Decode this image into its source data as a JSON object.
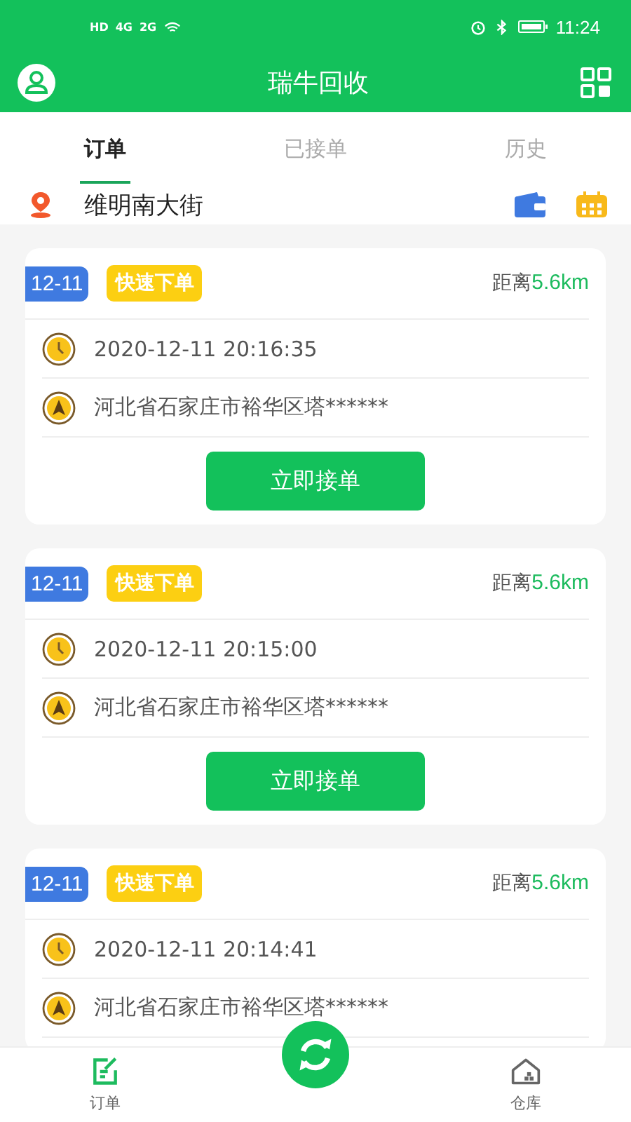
{
  "status_bar": {
    "indicators": [
      "HD",
      "4G",
      "2G"
    ],
    "time": "11:24"
  },
  "header": {
    "title": "瑞牛回收"
  },
  "tabs": [
    {
      "label": "订单",
      "selected": true
    },
    {
      "label": "已接单",
      "selected": false
    },
    {
      "label": "历史",
      "selected": false
    }
  ],
  "location": {
    "street": "维明南大街"
  },
  "orders": [
    {
      "date": "12-11",
      "tag": "快速下单",
      "distance_label": "距离",
      "distance": "5.6km",
      "time": "2020-12-11 20:16:35",
      "address": "河北省石家庄市裕华区塔******",
      "button": "立即接单"
    },
    {
      "date": "12-11",
      "tag": "快速下单",
      "distance_label": "距离",
      "distance": "5.6km",
      "time": "2020-12-11 20:15:00",
      "address": "河北省石家庄市裕华区塔******",
      "button": "立即接单"
    },
    {
      "date": "12-11",
      "tag": "快速下单",
      "distance_label": "距离",
      "distance": "5.6km",
      "time": "2020-12-11 20:14:41",
      "address": "河北省石家庄市裕华区塔******"
    }
  ],
  "bottom_nav": [
    {
      "kind": "orders",
      "label": "订单",
      "selected": true
    },
    {
      "kind": "refresh"
    },
    {
      "kind": "warehouse",
      "label": "仓库",
      "selected": false
    }
  ]
}
